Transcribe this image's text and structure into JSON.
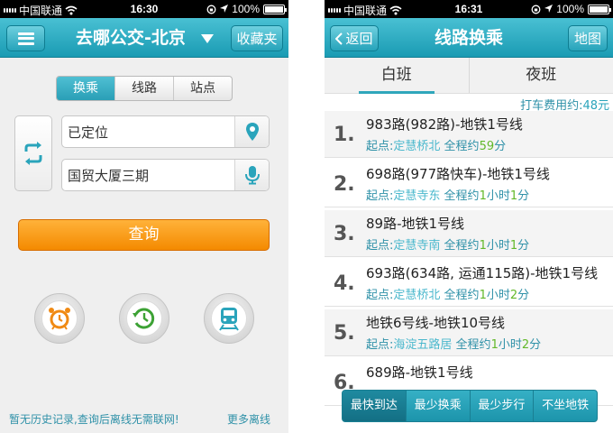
{
  "status_left": {
    "carrier": "中国联通",
    "time": "16:30",
    "battery": "100%"
  },
  "status_right": {
    "carrier": "中国联通",
    "time": "16:31",
    "battery": "100%"
  },
  "home": {
    "title": "去哪公交-北京",
    "favorites_label": "收藏夹",
    "modes": [
      {
        "label": "换乘",
        "active": true
      },
      {
        "label": "线路",
        "active": false
      },
      {
        "label": "站点",
        "active": false
      }
    ],
    "origin_value": "已定位",
    "destination_value": "国贸大厦三期",
    "query_label": "查询",
    "footer_text": "暂无历史记录,查询后离线无需联网!",
    "more_offline": "更多离线"
  },
  "results": {
    "back_label": "返回",
    "title": "线路换乘",
    "map_label": "地图",
    "tabs": [
      {
        "label": "白班",
        "active": true
      },
      {
        "label": "夜班",
        "active": false
      }
    ],
    "taxi_label": "打车费用约:",
    "taxi_value": "48元",
    "routes": [
      {
        "index": "1.",
        "name": "983路(982路)-地铁1号线",
        "start_label": "起点:",
        "start": "定慧桥北",
        "total_label": "全程约",
        "hours": "",
        "hour_unit": "",
        "minutes": "59",
        "min_unit": "分"
      },
      {
        "index": "2.",
        "name": "698路(977路快车)-地铁1号线",
        "start_label": "起点:",
        "start": "定慧寺东",
        "total_label": "全程约",
        "hours": "1",
        "hour_unit": "小时",
        "minutes": "1",
        "min_unit": "分"
      },
      {
        "index": "3.",
        "name": "89路-地铁1号线",
        "start_label": "起点:",
        "start": "定慧寺南",
        "total_label": "全程约",
        "hours": "1",
        "hour_unit": "小时",
        "minutes": "1",
        "min_unit": "分"
      },
      {
        "index": "4.",
        "name": "693路(634路, 运通115路)-地铁1号线",
        "start_label": "起点:",
        "start": "定慧桥北",
        "total_label": "全程约",
        "hours": "1",
        "hour_unit": "小时",
        "minutes": "2",
        "min_unit": "分"
      },
      {
        "index": "5.",
        "name": "地铁6号线-地铁10号线",
        "start_label": "起点:",
        "start": "海淀五路居",
        "total_label": "全程约",
        "hours": "1",
        "hour_unit": "小时",
        "minutes": "2",
        "min_unit": "分"
      },
      {
        "index": "6.",
        "name": "689路-地铁1号线",
        "start_label": "",
        "start": "",
        "total_label": "",
        "hours": "",
        "hour_unit": "",
        "minutes": "",
        "min_unit": ""
      }
    ],
    "filters": [
      {
        "label": "最快到达",
        "active": true
      },
      {
        "label": "最少换乘",
        "active": false
      },
      {
        "label": "最少步行",
        "active": false
      },
      {
        "label": "不坐地铁",
        "active": false
      }
    ]
  },
  "colors": {
    "nav": "#1a9bb3",
    "accent_green": "#62b82a",
    "query_orange": "#f48a00",
    "link_blue": "#2f91a8"
  },
  "icons": [
    "menu-icon",
    "dropdown-caret-icon",
    "swap-icon",
    "location-pin-icon",
    "microphone-icon",
    "alarm-clock-icon",
    "history-clock-icon",
    "train-icon",
    "wifi-icon",
    "battery-icon"
  ]
}
